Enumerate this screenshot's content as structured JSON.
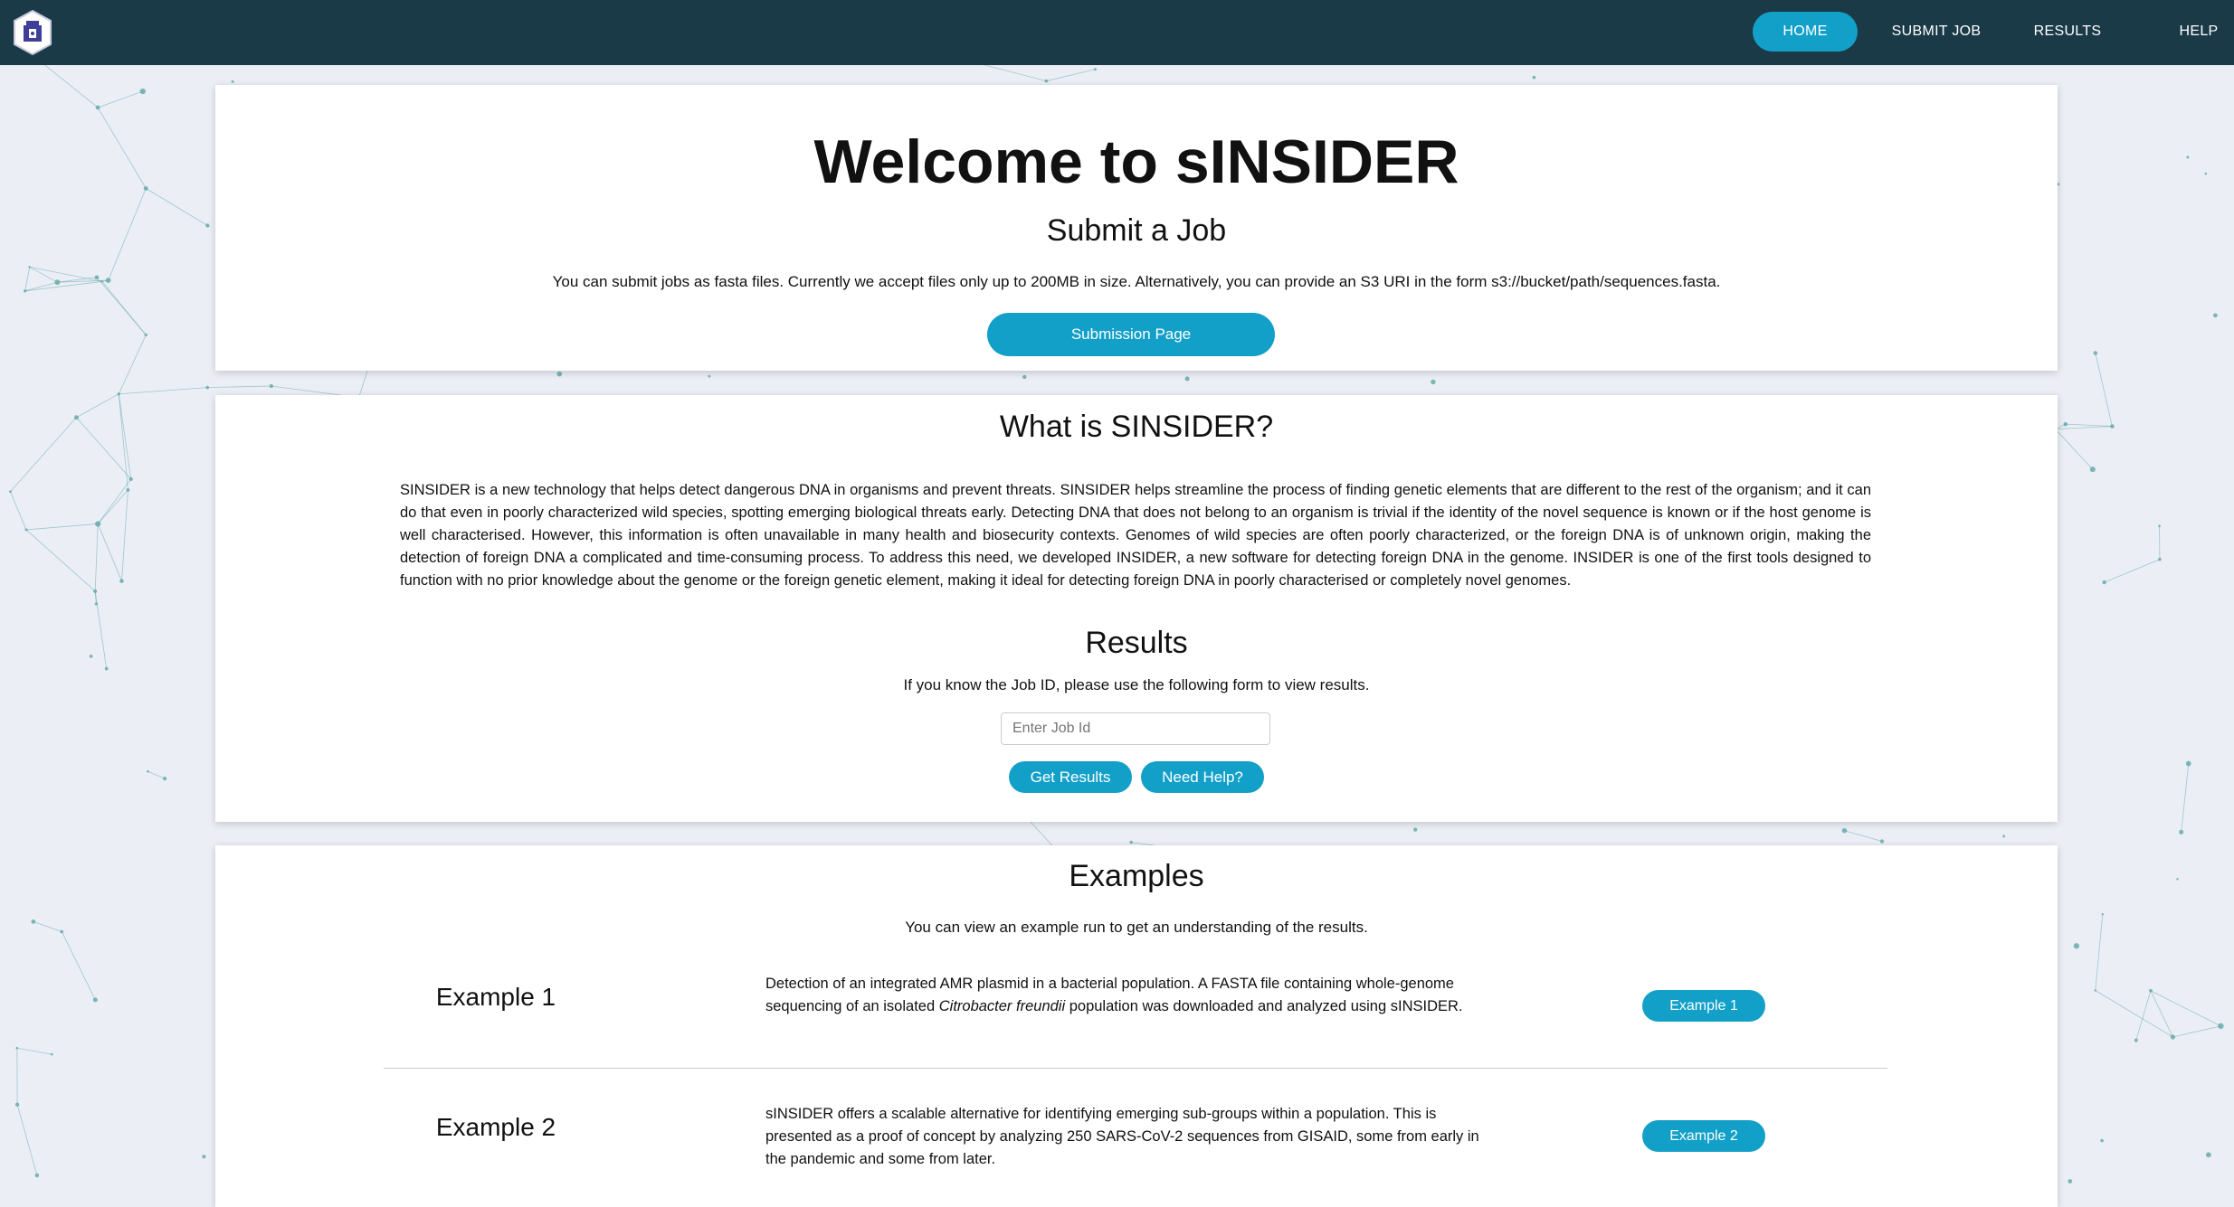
{
  "nav": {
    "logo_alt": "sINSIDER logo",
    "items": [
      {
        "label": "HOME",
        "active": true
      },
      {
        "label": "SUBMIT JOB",
        "active": false
      },
      {
        "label": "RESULTS",
        "active": false
      },
      {
        "label": "HELP",
        "active": false
      }
    ]
  },
  "hero": {
    "title": "Welcome to sINSIDER",
    "subtitle": "Submit a Job",
    "description": "You can submit jobs as fasta files. Currently we accept files only up to 200MB in size. Alternatively, you can provide an S3 URI in the form s3://bucket/path/sequences.fasta.",
    "button_label": "Submission Page"
  },
  "about": {
    "heading": "What is SINSIDER?",
    "text": "SINSIDER is a new technology that helps detect dangerous DNA in organisms and prevent threats. SINSIDER helps streamline the process of finding genetic elements that are different to the rest of the organism; and it can do that even in poorly characterized wild species, spotting emerging biological threats early. Detecting DNA that does not belong to an organism is trivial if the identity of the novel sequence is known or if the host genome is well characterised. However, this information is often unavailable in many health and biosecurity contexts. Genomes of wild species are often poorly characterized, or the foreign DNA is of unknown origin, making the detection of foreign DNA a complicated and time-consuming process. To address this need, we developed INSIDER, a new software for detecting foreign DNA in the genome. INSIDER is one of the first tools designed to function with no prior knowledge about the genome or the foreign genetic element, making it ideal for detecting foreign DNA in poorly characterised or completely novel genomes."
  },
  "results": {
    "heading": "Results",
    "description": "If you know the Job ID, please use the following form to view results.",
    "input_placeholder": "Enter Job Id",
    "input_value": "",
    "get_results_label": "Get Results",
    "need_help_label": "Need Help?"
  },
  "examples": {
    "heading": "Examples",
    "description": "You can view an example run to get an understanding of the results.",
    "items": [
      {
        "name": "Example 1",
        "desc_before": "Detection of an integrated AMR plasmid in a bacterial population. A FASTA file containing whole-genome sequencing of an isolated ",
        "desc_italic": "Citrobacter freundii",
        "desc_after": " population was downloaded and analyzed using sINSIDER.",
        "button_label": "Example 1"
      },
      {
        "name": "Example 2",
        "desc_before": "sINSIDER offers a scalable alternative for identifying emerging sub-groups within a population. This is presented as a proof of concept by analyzing 250 SARS-CoV-2 sequences from GISAID, some from early in the pandemic and some from later.",
        "desc_italic": "",
        "desc_after": "",
        "button_label": "Example 2"
      }
    ]
  },
  "colors": {
    "navbar": "#1b3a48",
    "accent": "#13a0c8",
    "page_bg": "#eceef6",
    "network_lines": "#5fa8a8"
  }
}
